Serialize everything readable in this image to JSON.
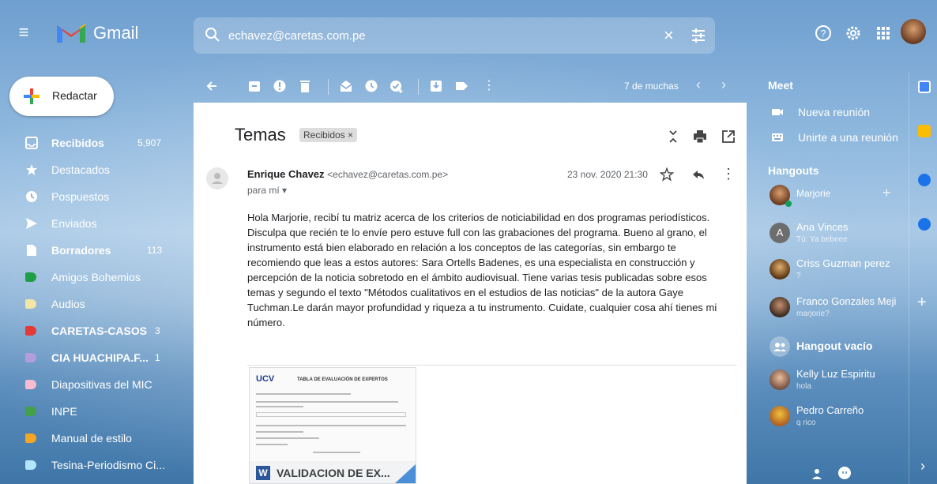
{
  "header": {
    "app_name": "Gmail",
    "search_value": "echavez@caretas.com.pe"
  },
  "compose": {
    "label": "Redactar"
  },
  "nav": {
    "items": [
      {
        "label": "Recibidos",
        "count": "5,907",
        "icon": "inbox-icon",
        "bold": true
      },
      {
        "label": "Destacados",
        "count": "",
        "icon": "star-icon",
        "bold": false
      },
      {
        "label": "Pospuestos",
        "count": "",
        "icon": "clock-icon",
        "bold": false
      },
      {
        "label": "Enviados",
        "count": "",
        "icon": "send-icon",
        "bold": false
      },
      {
        "label": "Borradores",
        "count": "113",
        "icon": "draft-icon",
        "bold": true
      },
      {
        "label": "Amigos Bohemios",
        "count": "",
        "icon": "label-icon",
        "color": "#1e9e45",
        "bold": false
      },
      {
        "label": "Audios",
        "count": "",
        "icon": "label-icon",
        "color": "#f4e4a8",
        "bold": false
      },
      {
        "label": "CARETAS-CASOS",
        "count": "3",
        "icon": "label-icon",
        "color": "#e53935",
        "bold": true
      },
      {
        "label": "CIA HUACHIPA.F...",
        "count": "1",
        "icon": "label-icon",
        "color": "#b39ddb",
        "bold": true
      },
      {
        "label": "Diapositivas del MIC",
        "count": "",
        "icon": "label-icon",
        "color": "#f8bbd0",
        "bold": false
      },
      {
        "label": "INPE",
        "count": "",
        "icon": "label-icon",
        "color": "#43a047",
        "bold": false
      },
      {
        "label": "Manual de estilo",
        "count": "",
        "icon": "label-icon",
        "color": "#f5a623",
        "bold": false
      },
      {
        "label": "Tesina-Periodismo Ci...",
        "count": "",
        "icon": "label-icon",
        "color": "#b3e5fc",
        "bold": false
      }
    ]
  },
  "toolbar": {
    "count": "7 de muchas"
  },
  "message": {
    "subject": "Temas",
    "label_chip": "Recibidos ×",
    "sender_name": "Enrique Chavez",
    "sender_email": "<echavez@caretas.com.pe>",
    "to": "para mí ▾",
    "date": "23 nov. 2020 21:30",
    "body": "Hola Marjorie, recibí tu matriz acerca de los criterios de noticiabilidad en dos programas periodísticos. Disculpa que recién te lo envíe pero estuve full con las grabaciones del programa. Bueno al grano, el instrumento está bien elaborado en relación a los conceptos de las categorías, sin embargo te recomiendo que leas a estos autores: Sara Ortells Badenes, es una especialista en construcción y percepción de la noticia sobretodo en el ámbito audiovisual. Tiene varias tesis publicadas sobre esos temas y segundo el texto \"Métodos cualitativos en el estudios de las noticias\" de la autora Gaye Tuchman.Le darán mayor profundidad y riqueza a tu instrumento. Cuidate, cualquier cosa ahí tienes mi número.",
    "attachment": {
      "logo": "UCV",
      "doc_title": "TABLA DE EVALUACIÓN DE EXPERTOS",
      "name": "VALIDACION DE EX..."
    }
  },
  "right_panel": {
    "meet_title": "Meet",
    "meet_items": [
      "Nueva reunión",
      "Unirte a una reunión"
    ],
    "hangouts_title": "Hangouts",
    "self_name": "Marjorie",
    "contacts": [
      {
        "name": "Ana Vinces",
        "sub": "Tú: Ya bebeee",
        "avatar_letter": "A"
      },
      {
        "name": "Criss Guzman perez",
        "sub": "?",
        "avatar_letter": ""
      },
      {
        "name": "Franco Gonzales Meji",
        "sub": "marjorie?",
        "avatar_letter": ""
      },
      {
        "name": "Hangout vacío",
        "sub": "",
        "avatar_letter": ""
      },
      {
        "name": "Kelly Luz Espiritu",
        "sub": "hola",
        "avatar_letter": ""
      },
      {
        "name": "Pedro Carreño",
        "sub": "q rico",
        "avatar_letter": ""
      }
    ]
  }
}
